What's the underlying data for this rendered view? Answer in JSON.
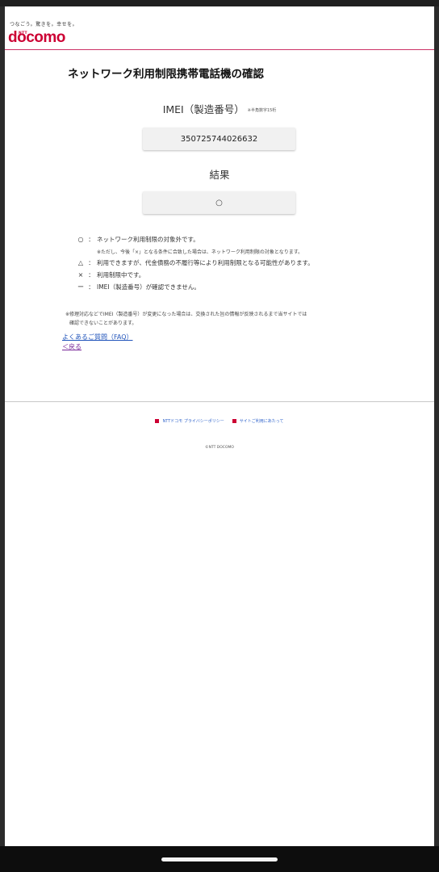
{
  "header": {
    "tagline": "つなごう。驚きを。幸せを。",
    "ntt_label": "NTT",
    "logo_text": "docomo"
  },
  "page": {
    "title": "ネットワーク利用制限携帯電話機の確認"
  },
  "imei": {
    "label": "IMEI（製造番号）",
    "sub_label": "※半角数字15桁",
    "value": "350725744026632"
  },
  "result": {
    "label": "結果",
    "value": "○"
  },
  "legend": {
    "items": [
      {
        "symbol": "○",
        "colon": "：",
        "text": "ネットワーク利用制限の対象外です。"
      },
      {
        "symbol": "△",
        "colon": "：",
        "text": "利用できますが、代金債務の不履行等により利用制限となる可能性があります。"
      },
      {
        "symbol": "×",
        "colon": "：",
        "text": "利用制限中です。"
      },
      {
        "symbol": "ー",
        "colon": "：",
        "text": "IMEI（製造番号）が確認できません。"
      }
    ],
    "note": "※ただし、今後「×」となる条件に合致した場合は、ネットワーク利用制限の対象となります。"
  },
  "disclaimer": {
    "line1": "※修理対応などでIMEI（製造番号）が変更になった場合は、交換された旨の情報が反映されるまで当サイトでは",
    "line2": "確認できないことがあります。"
  },
  "links": {
    "faq": "よくあるご質問（FAQ）",
    "back": "＜戻る"
  },
  "footer": {
    "privacy": "NTTドコモ プライバシーポリシー",
    "site_usage": "サイトご利用にあたって",
    "copyright": "©NTT DOCOMO"
  },
  "colors": {
    "brand": "#cc0033",
    "link": "#2255bb",
    "visited_link": "#7a2a99"
  }
}
